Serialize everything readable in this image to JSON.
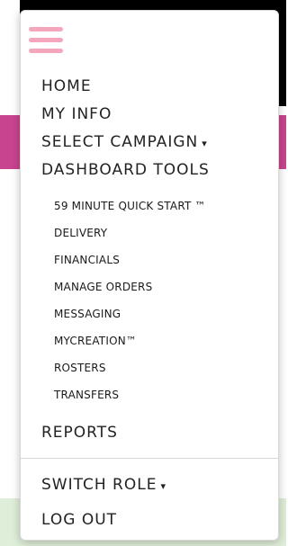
{
  "menu": {
    "home": "HOME",
    "my_info": "MY INFO",
    "select_campaign": "SELECT CAMPAIGN",
    "dashboard_tools": "DASHBOARD TOOLS",
    "sub_items": [
      "59 MINUTE QUICK START ™",
      "DELIVERY",
      "FINANCIALS",
      "MANAGE ORDERS",
      "MESSAGING",
      "MYCREATION™",
      "ROSTERS",
      "TRANSFERS"
    ],
    "reports": "REPORTS",
    "switch_role": "SWITCH ROLE",
    "log_out": "LOG OUT",
    "caret": "▾"
  },
  "colors": {
    "hamburger": "#f4a6bd",
    "pink_band": "#c9448e",
    "topbar": "#000000",
    "footer_tint": "#dfeed8"
  },
  "icons": {
    "hamburger": "hamburger-menu-icon",
    "dropdown": "chevron-down-icon"
  }
}
